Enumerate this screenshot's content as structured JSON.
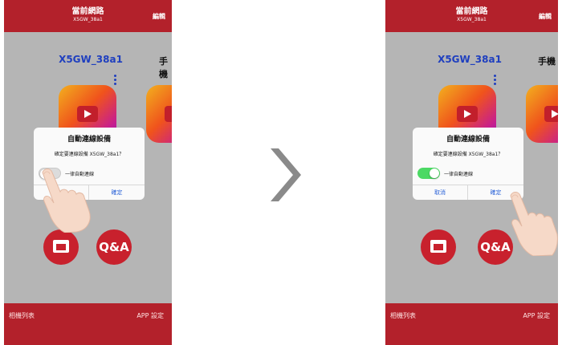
{
  "left_screen": {
    "header": {
      "title": "當前網路",
      "subtitle": "X5GW_38a1",
      "edit_label": "編輯"
    },
    "device_name": "X5GW_38a1",
    "device_name_2": "手機",
    "qa_label": "Q&A",
    "dialog": {
      "title": "自動連線設備",
      "message": "確定要連線設備 X5GW_38a1？",
      "toggle_label": "一律自動連線",
      "toggle_on": false,
      "cancel_label": "",
      "confirm_label": "確定"
    },
    "bottom_bar": {
      "left_label": "相機列表",
      "right_label": "APP 設定"
    }
  },
  "right_screen": {
    "header": {
      "title": "當前網路",
      "subtitle": "X5GW_38a1",
      "edit_label": "編輯"
    },
    "device_name": "X5GW_38a1",
    "device_name_2": "手機",
    "qa_label": "Q&A",
    "dialog": {
      "title": "自動連線設備",
      "message": "確定要連線設備 X5GW_38a1？",
      "toggle_label": "一律自動連線",
      "toggle_on": true,
      "cancel_label": "取消",
      "confirm_label": "確定"
    },
    "bottom_bar": {
      "left_label": "相機列表",
      "right_label": "APP 設定"
    }
  },
  "colors": {
    "brand_red": "#b3212b",
    "link_blue": "#2b63d8",
    "toggle_green": "#4cd964",
    "screen_gray": "#b5b5b5"
  },
  "icons": [
    "camera-app-icon",
    "folder-photo-icon",
    "more-vert-icon",
    "chevron-right-icon",
    "hand-pointer-icon"
  ]
}
